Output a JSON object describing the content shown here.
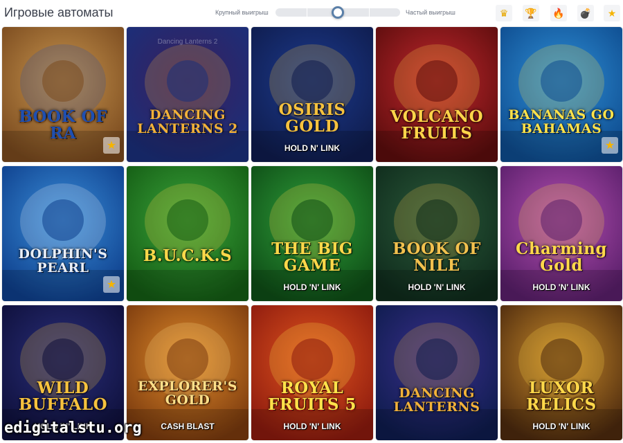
{
  "header": {
    "title": "Игровые автоматы",
    "volatility": {
      "left_label": "Крупный выигрыш",
      "right_label": "Частый выигрыш",
      "value": 0.5,
      "segments": 4
    },
    "filters": [
      {
        "name": "crown",
        "icon": "♛",
        "color": "#e6a700"
      },
      {
        "name": "trophy",
        "icon": "🏆",
        "color": "#d4a017"
      },
      {
        "name": "fire",
        "icon": "🔥",
        "color": "#f08a00"
      },
      {
        "name": "bomb",
        "icon": "💣",
        "color": "#333333"
      },
      {
        "name": "star",
        "icon": "★",
        "color": "#f5b400"
      }
    ]
  },
  "games": [
    {
      "title": "BOOK OF RA",
      "favorite": true,
      "colors": [
        "#c7954f",
        "#7a4a1e"
      ],
      "accent": "#1f4fb0"
    },
    {
      "title": "DANCING LANTERNS 2",
      "caption": "Dancing Lanterns 2",
      "favorite": false,
      "colors": [
        "#3a1f5c",
        "#1a2f7a"
      ],
      "accent": "#f2b13a"
    },
    {
      "title": "OSIRIS GOLD",
      "subtitle": "HOLD N' LINK",
      "favorite": false,
      "colors": [
        "#1c3a8c",
        "#0f1c4d"
      ],
      "accent": "#f6c23e"
    },
    {
      "title": "VOLCANO FRUITS",
      "favorite": false,
      "colors": [
        "#c1272d",
        "#5c0d0d"
      ],
      "accent": "#ffd54a"
    },
    {
      "title": "BANANAS GO BAHAMAS",
      "favorite": true,
      "colors": [
        "#2f8fd6",
        "#0e4c8f"
      ],
      "accent": "#ffe24a"
    },
    {
      "title": "DOLPHIN'S PEARL",
      "favorite": true,
      "colors": [
        "#3a8ed9",
        "#0e3f8c"
      ],
      "accent": "#e9eef6"
    },
    {
      "title": "B.U.C.K.S",
      "favorite": false,
      "colors": [
        "#3aa33a",
        "#145c14"
      ],
      "accent": "#ffd84a"
    },
    {
      "title": "THE BIG GAME",
      "subtitle": "HOLD 'N' LINK",
      "favorite": false,
      "colors": [
        "#2f9e3a",
        "#0e4d16"
      ],
      "accent": "#ffd84a"
    },
    {
      "title": "BOOK OF NILE",
      "subtitle": "HOLD 'N' LINK",
      "favorite": false,
      "colors": [
        "#2b5a3a",
        "#0f2b1c"
      ],
      "accent": "#f2c14e"
    },
    {
      "title": "Charming Gold",
      "subtitle": "HOLD 'N' LINK",
      "favorite": false,
      "colors": [
        "#b34fb0",
        "#5a1f6b"
      ],
      "accent": "#ffd84a"
    },
    {
      "title": "WILD BUFFALO",
      "subtitle": "HOLD 'N' LINK",
      "favorite": false,
      "colors": [
        "#2a2f7a",
        "#0e0f3a"
      ],
      "accent": "#f6c23e"
    },
    {
      "title": "EXPLORER'S GOLD",
      "subtitle": "CASH BLAST",
      "favorite": false,
      "colors": [
        "#e08a2a",
        "#7a3a0e"
      ],
      "accent": "#ffe08a"
    },
    {
      "title": "ROYAL FRUITS 5",
      "subtitle": "HOLD 'N' LINK",
      "favorite": false,
      "colors": [
        "#e0541e",
        "#8c1a0e"
      ],
      "accent": "#ffe24a"
    },
    {
      "title": "DANCING LANTERNS",
      "favorite": false,
      "colors": [
        "#3a2f8c",
        "#0e1c4d"
      ],
      "accent": "#f2b13a"
    },
    {
      "title": "LUXOR RELICS",
      "subtitle": "HOLD 'N' LINK",
      "favorite": false,
      "colors": [
        "#c78a2a",
        "#4d2a0e"
      ],
      "accent": "#ffd84a"
    }
  ],
  "watermark": "edigitalstu.org"
}
